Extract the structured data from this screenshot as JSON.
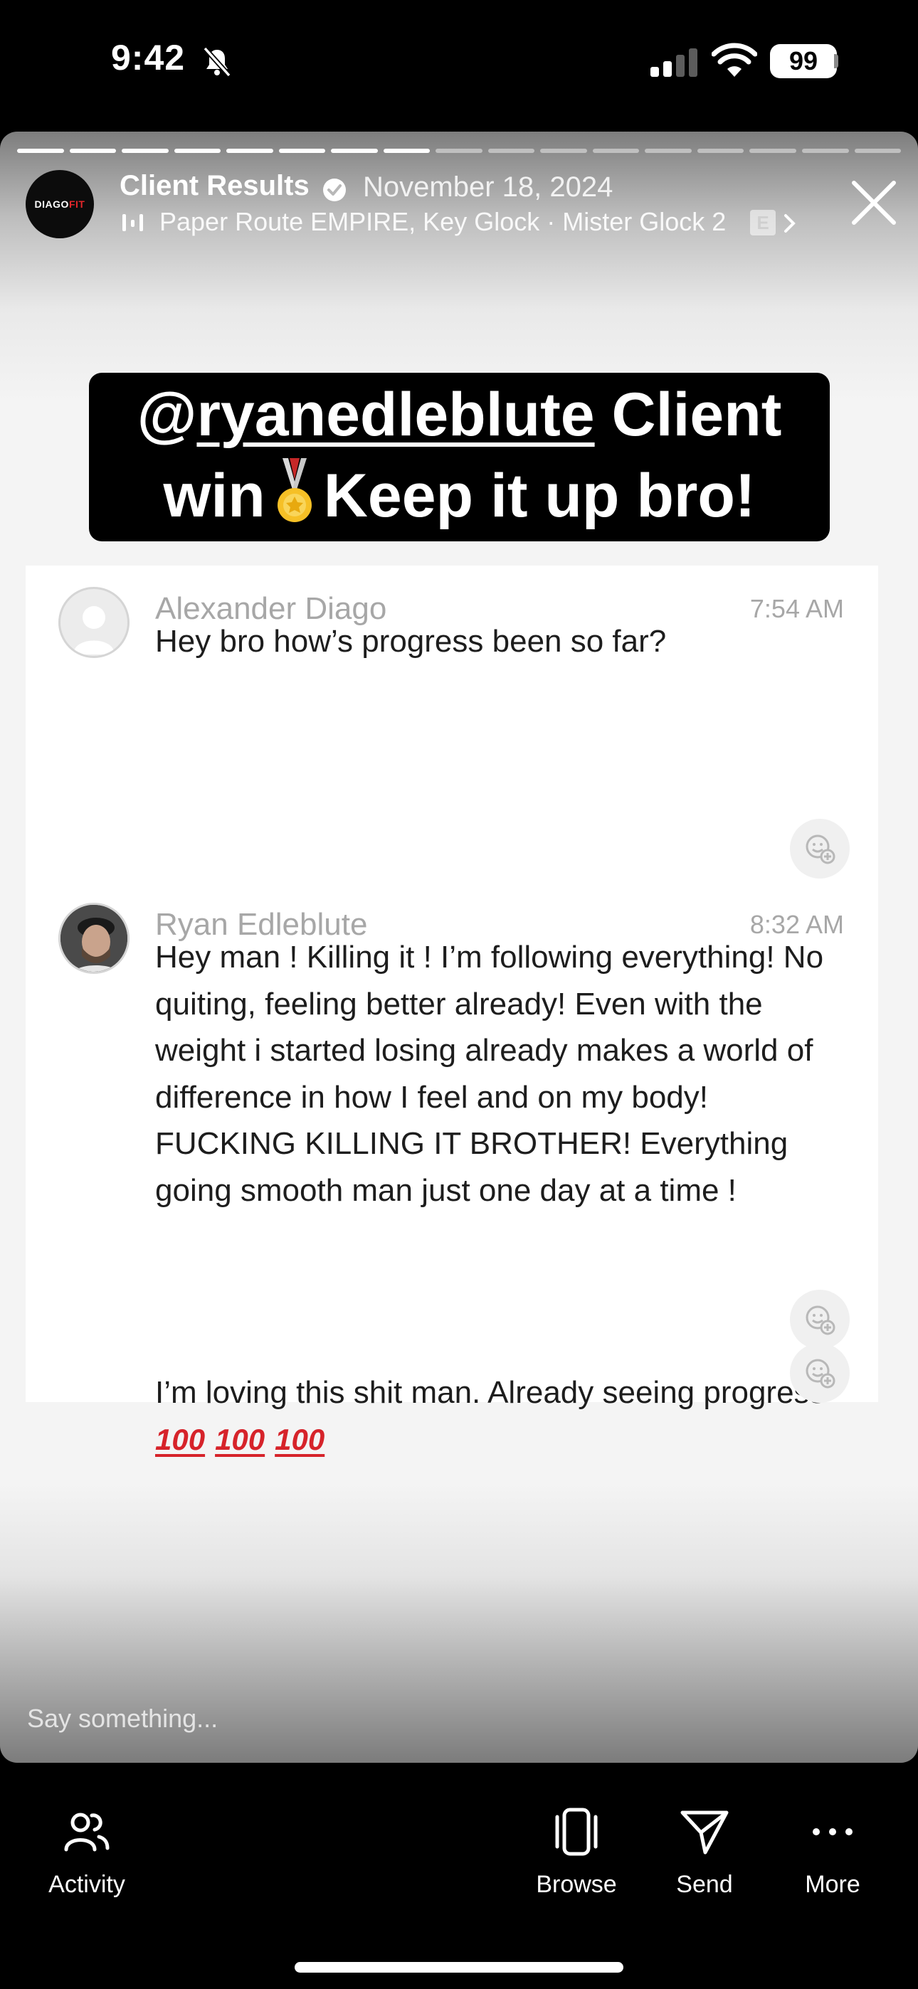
{
  "status_bar": {
    "time": "9:42",
    "battery": "99"
  },
  "story": {
    "segments_total": 17,
    "segments_done": 8,
    "avatar_logo": {
      "part1": "DIAGO",
      "part2": "FIT"
    },
    "title": "Client Results",
    "date": "November 18, 2024",
    "music": "Paper Route EMPIRE, Key Glock · Mister Glock 2",
    "explicit": "E",
    "caption": {
      "at": "@",
      "mention": "ryanedleblute",
      "line1_rest": " Client",
      "line2_start": "win",
      "line2_end": "Keep it up bro!"
    },
    "reply_placeholder": "Say something..."
  },
  "chat": {
    "messages": [
      {
        "sender": "Alexander Diago",
        "time": "7:54 AM",
        "text": "Hey bro how’s progress been so far?"
      },
      {
        "sender": "Ryan Edleblute",
        "time": "8:32 AM",
        "text": "Hey man ! Killing it ! I’m following everything! No quiting, feeling better already! Even with the weight i started losing already makes a world of difference in how I feel and on my body! FUCKING KILLING IT BROTHER! Everything going smooth man just one day at a time !"
      },
      {
        "sender": "",
        "time": "",
        "text": "I’m loving this shit man. Already seeing progress",
        "emoji": [
          "100",
          "100",
          "100"
        ]
      }
    ]
  },
  "nav": {
    "activity": "Activity",
    "browse": "Browse",
    "send": "Send",
    "more": "More"
  },
  "colors": {
    "accent_red": "#e3262a",
    "background": "#000000",
    "card": "#ffffff"
  }
}
